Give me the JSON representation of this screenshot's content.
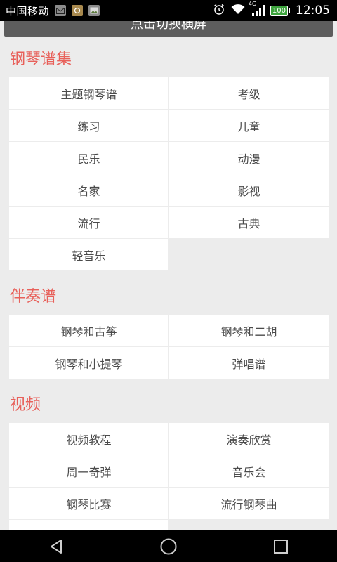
{
  "status_bar": {
    "carrier": "中国移动",
    "network": "4G",
    "battery": "100",
    "time": "12:05"
  },
  "banner": {
    "label": "点击切换横屏"
  },
  "sections": [
    {
      "title": "钢琴谱集",
      "items": [
        "主题钢琴谱",
        "考级",
        "练习",
        "儿童",
        "民乐",
        "动漫",
        "名家",
        "影视",
        "流行",
        "古典",
        "轻音乐"
      ]
    },
    {
      "title": "伴奏谱",
      "items": [
        "钢琴和古筝",
        "钢琴和二胡",
        "钢琴和小提琴",
        "弹唱谱"
      ]
    },
    {
      "title": "视频",
      "items": [
        "视频教程",
        "演奏欣赏",
        "周一奇弹",
        "音乐会",
        "钢琴比赛",
        "流行钢琴曲"
      ]
    }
  ],
  "colors": {
    "accent": "#e8605a",
    "background": "#ececec",
    "cell": "#ffffff",
    "banner": "#5d5d5d"
  }
}
